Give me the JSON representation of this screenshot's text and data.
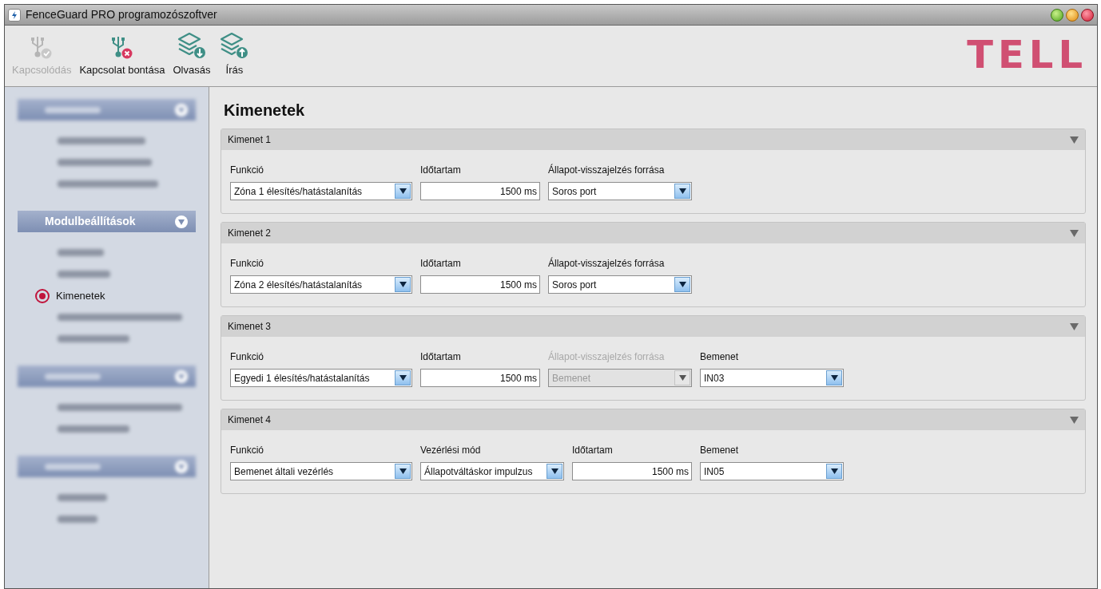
{
  "window": {
    "title": "FenceGuard PRO programozószoftver"
  },
  "toolbar": [
    {
      "label": "Kapcsolódás",
      "kind": "usb-check",
      "disabled": true
    },
    {
      "label": "Kapcsolat bontása",
      "kind": "usb-cross",
      "disabled": false
    },
    {
      "label": "Olvasás",
      "kind": "layers-down",
      "disabled": false
    },
    {
      "label": "Írás",
      "kind": "layers-up",
      "disabled": false
    }
  ],
  "logo": "TELL",
  "sidebar": {
    "groups": [
      {
        "blurred": true,
        "expanded": true,
        "items": [
          {
            "blurred": true
          },
          {
            "blurred": true
          },
          {
            "blurred": true
          }
        ]
      },
      {
        "title": "Modulbeállítások",
        "blurred": false,
        "expanded": true,
        "items": [
          {
            "blurred": true
          },
          {
            "blurred": true
          },
          {
            "label": "Kimenetek",
            "blurred": false,
            "selected": true
          },
          {
            "blurred": true
          },
          {
            "blurred": true
          }
        ]
      },
      {
        "blurred": true,
        "expanded": true,
        "items": [
          {
            "blurred": true
          },
          {
            "blurred": true
          }
        ]
      },
      {
        "blurred": true,
        "expanded": true,
        "items": [
          {
            "blurred": true
          },
          {
            "blurred": true
          }
        ]
      }
    ]
  },
  "page": {
    "title": "Kimenetek"
  },
  "outputs": [
    {
      "title": "Kimenet 1",
      "expanded": true,
      "fields": [
        {
          "kind": "wide-select",
          "label": "Funkció",
          "value": "Zóna 1 élesítés/hatástalanítás",
          "disabled": false
        },
        {
          "kind": "number",
          "label": "Időtartam",
          "value": "1500 ms",
          "disabled": false
        },
        {
          "kind": "select",
          "label": "Állapot-visszajelzés forrása",
          "value": "Soros port",
          "disabled": false
        }
      ]
    },
    {
      "title": "Kimenet 2",
      "expanded": true,
      "fields": [
        {
          "kind": "wide-select",
          "label": "Funkció",
          "value": "Zóna 2 élesítés/hatástalanítás",
          "disabled": false
        },
        {
          "kind": "number",
          "label": "Időtartam",
          "value": "1500 ms",
          "disabled": false
        },
        {
          "kind": "select",
          "label": "Állapot-visszajelzés forrása",
          "value": "Soros port",
          "disabled": false
        }
      ]
    },
    {
      "title": "Kimenet 3",
      "expanded": true,
      "fields": [
        {
          "kind": "wide-select",
          "label": "Funkció",
          "value": "Egyedi 1 élesítés/hatástalanítás",
          "disabled": false
        },
        {
          "kind": "number",
          "label": "Időtartam",
          "value": "1500 ms",
          "disabled": false
        },
        {
          "kind": "select",
          "label": "Állapot-visszajelzés forrása",
          "value": "Bemenet",
          "disabled": true
        },
        {
          "kind": "select",
          "label": "Bemenet",
          "value": "IN03",
          "disabled": false
        }
      ]
    },
    {
      "title": "Kimenet 4",
      "expanded": true,
      "fields": [
        {
          "kind": "wide-select",
          "label": "Funkció",
          "value": "Bemenet általi vezérlés",
          "disabled": false
        },
        {
          "kind": "select",
          "label": "Vezérlési mód",
          "value": "Állapotváltáskor impulzus",
          "disabled": false
        },
        {
          "kind": "number",
          "label": "Időtartam",
          "value": "1500 ms",
          "disabled": false
        },
        {
          "kind": "select",
          "label": "Bemenet",
          "value": "IN05",
          "disabled": false
        }
      ]
    }
  ]
}
